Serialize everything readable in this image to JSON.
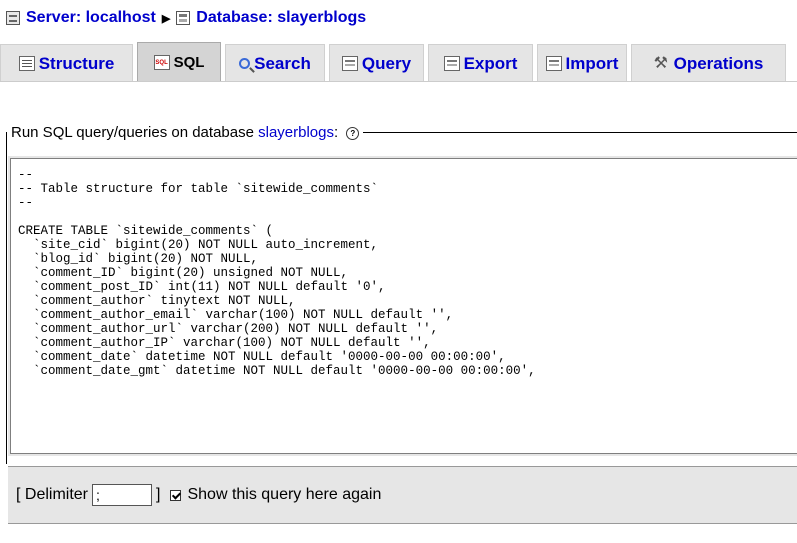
{
  "breadcrumb": {
    "server_label": "Server: localhost",
    "database_label": "Database: slayerblogs",
    "server_icon": "server-icon",
    "database_icon": "database-icon"
  },
  "tabs": [
    {
      "label": "Structure",
      "icon": "structure-icon"
    },
    {
      "label": "SQL",
      "icon": "sql-icon",
      "active": true
    },
    {
      "label": "Search",
      "icon": "search-icon"
    },
    {
      "label": "Query",
      "icon": "query-icon"
    },
    {
      "label": "Export",
      "icon": "export-icon"
    },
    {
      "label": "Import",
      "icon": "import-icon"
    },
    {
      "label": "Operations",
      "icon": "operations-icon"
    }
  ],
  "sql_panel": {
    "legend_prefix": "Run SQL query/queries on database ",
    "legend_db": "slayerblogs",
    "legend_suffix": ":",
    "help_icon": "help-icon",
    "help_glyph": "?"
  },
  "editor": {
    "lines": [
      "--",
      "-- Table structure for table `sitewide_comments`",
      "--",
      "",
      "CREATE TABLE `sitewide_comments` (",
      "  `site_cid` bigint(20) NOT NULL auto_increment,",
      "  `blog_id` bigint(20) NOT NULL,",
      "  `comment_ID` bigint(20) unsigned NOT NULL,",
      "  `comment_post_ID` int(11) NOT NULL default '0',",
      "  `comment_author` tinytext NOT NULL,",
      "  `comment_author_email` varchar(100) NOT NULL default '',",
      "  `comment_author_url` varchar(200) NOT NULL default '',",
      "  `comment_author_IP` varchar(100) NOT NULL default '',",
      "  `comment_date` datetime NOT NULL default '0000-00-00 00:00:00',",
      "  `comment_date_gmt` datetime NOT NULL default '0000-00-00 00:00:00',"
    ]
  },
  "footer": {
    "delimiter_open": "[ Delimiter",
    "delimiter_value": ";",
    "delimiter_close": "]",
    "show_again_checked": true,
    "show_again_label": "Show this query here again"
  }
}
